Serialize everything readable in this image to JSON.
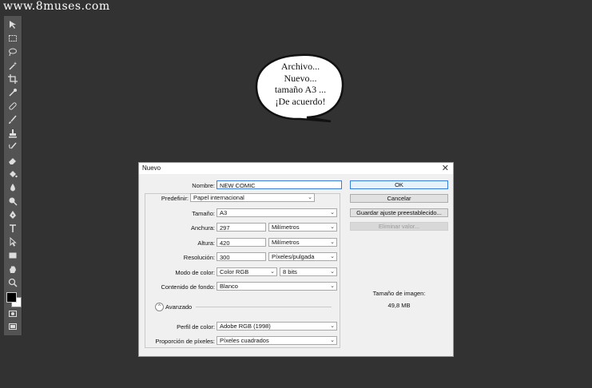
{
  "watermark": "www.8muses.com",
  "bubble": {
    "lines": [
      "Archivo...",
      "Nuevo...",
      "tamaño A3 ...",
      "¡De acuerdo!"
    ]
  },
  "toolbar": {
    "tools": [
      "move-tool",
      "marquee-tool",
      "lasso-tool",
      "magic-wand-tool",
      "crop-tool",
      "eyedropper-tool",
      "healing-brush-tool",
      "brush-tool",
      "clone-stamp-tool",
      "history-brush-tool",
      "eraser-tool",
      "paint-bucket-tool",
      "blur-tool",
      "dodge-tool",
      "pen-tool",
      "type-tool",
      "path-selection-tool",
      "rectangle-tool",
      "hand-tool",
      "zoom-tool"
    ]
  },
  "dialog": {
    "title": "Nuevo",
    "close": "✕",
    "name_label": "Nombre:",
    "name_value": "NEW COMIC",
    "preset_label": "Predefinir:",
    "preset_value": "Papel internacional",
    "size_label": "Tamaño:",
    "size_value": "A3",
    "width_label": "Anchura:",
    "width_value": "297",
    "width_unit": "Milímetros",
    "height_label": "Altura:",
    "height_value": "420",
    "height_unit": "Milímetros",
    "resolution_label": "Resolución:",
    "resolution_value": "300",
    "resolution_unit": "Píxeles/pulgada",
    "color_mode_label": "Modo de color:",
    "color_mode_value": "Color RGB",
    "color_depth_value": "8 bits",
    "background_label": "Contenido de fondo:",
    "background_value": "Blanco",
    "advanced_label": "Avanzado",
    "profile_label": "Perfil de color:",
    "profile_value": "Adobe RGB (1998)",
    "pixel_ratio_label": "Proporción de píxeles:",
    "pixel_ratio_value": "Píxeles cuadrados",
    "ok_label": "OK",
    "cancel_label": "Cancelar",
    "save_preset_label": "Guardar ajuste preestablecido...",
    "delete_preset_label": "Eliminar valor...",
    "image_size_label": "Tamaño de imagen:",
    "image_size_value": "49,8 MB"
  },
  "colors": {
    "background": "#323232",
    "toolbar": "#535353",
    "dialog": "#f0f0f0",
    "accent": "#3b7ddd"
  }
}
